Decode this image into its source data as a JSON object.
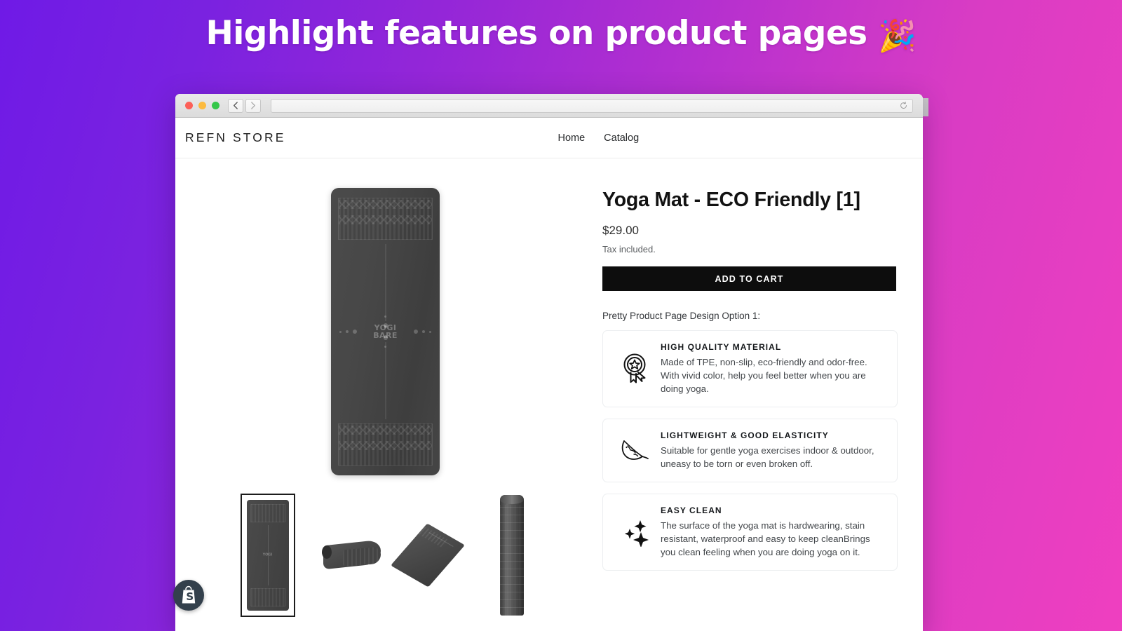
{
  "banner": {
    "headline": "Highlight features on product pages",
    "emoji": "🎉"
  },
  "browser": {
    "back_icon": "chevron-left-icon",
    "forward_icon": "chevron-right-icon",
    "reload_icon": "reload-icon",
    "new_tab_label": "+",
    "url_value": "",
    "url_placeholder": ""
  },
  "store": {
    "logo": "REFN STORE",
    "nav": [
      {
        "label": "Home"
      },
      {
        "label": "Catalog"
      }
    ]
  },
  "product": {
    "title": "Yoga Mat - ECO Friendly [1]",
    "price": "$29.00",
    "tax_note": "Tax included.",
    "add_to_cart_label": "ADD TO CART",
    "option_label": "Pretty Product Page Design Option 1:",
    "brand_line1": "YOGI",
    "brand_line2": "BARE",
    "gallery": {
      "thumbnails": [
        {
          "name": "mat-flat-front",
          "selected": true
        },
        {
          "name": "mat-folded",
          "selected": false
        },
        {
          "name": "mat-angled",
          "selected": false
        },
        {
          "name": "mat-rolled",
          "selected": false
        }
      ]
    },
    "features": [
      {
        "icon": "award-badge-icon",
        "title": "HIGH QUALITY MATERIAL",
        "description": "Made of TPE, non-slip, eco-friendly and odor-free. With vivid color, help you feel better when you are doing yoga."
      },
      {
        "icon": "feather-icon",
        "title": "LIGHTWEIGHT & GOOD ELASTICITY",
        "description": "Suitable for gentle yoga exercises indoor & outdoor, uneasy to be torn or even broken off."
      },
      {
        "icon": "sparkles-icon",
        "title": "EASY CLEAN",
        "description": "The surface of the yoga mat is hardwearing, stain resistant, waterproof and easy to keep cleanBrings you clean feeling when you are doing yoga on it."
      }
    ]
  },
  "badge": {
    "icon": "shopify-bag-icon"
  },
  "colors": {
    "gradient_start": "#6f1ae6",
    "gradient_end": "#ef3fc0",
    "button_bg": "#0d0d0d",
    "card_border": "#eceef0",
    "badge_bg": "#33404c"
  }
}
